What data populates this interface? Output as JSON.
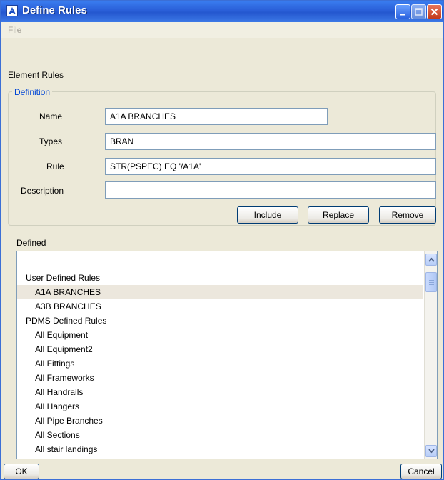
{
  "window": {
    "title": "Define Rules",
    "icon": "app-logo-icon",
    "controls": [
      "minimize-icon",
      "maximize-icon",
      "close-icon"
    ]
  },
  "menu": {
    "file": "File"
  },
  "section_title": "Element Rules",
  "definition": {
    "group_title": "Definition",
    "name_label": "Name",
    "name_value": "A1A BRANCHES",
    "types_label": "Types",
    "types_value": "BRAN",
    "rule_label": "Rule",
    "rule_value": "STR(PSPEC) EQ '/A1A'",
    "description_label": "Description",
    "description_value": "",
    "include_button": "Include",
    "replace_button": "Replace",
    "remove_button": "Remove"
  },
  "defined": {
    "label": "Defined",
    "items": [
      {
        "label": "User Defined Rules",
        "level": 0,
        "selected": false
      },
      {
        "label": "A1A BRANCHES",
        "level": 1,
        "selected": true
      },
      {
        "label": "A3B BRANCHES",
        "level": 1,
        "selected": false
      },
      {
        "label": "PDMS Defined Rules",
        "level": 0,
        "selected": false
      },
      {
        "label": "All Equipment",
        "level": 1,
        "selected": false
      },
      {
        "label": "All Equipment2",
        "level": 1,
        "selected": false
      },
      {
        "label": "All Fittings",
        "level": 1,
        "selected": false
      },
      {
        "label": "All Frameworks",
        "level": 1,
        "selected": false
      },
      {
        "label": "All Handrails",
        "level": 1,
        "selected": false
      },
      {
        "label": "All Hangers",
        "level": 1,
        "selected": false
      },
      {
        "label": "All Pipe Branches",
        "level": 1,
        "selected": false
      },
      {
        "label": "All Sections",
        "level": 1,
        "selected": false
      },
      {
        "label": "All stair landings",
        "level": 1,
        "selected": false
      }
    ]
  },
  "footer": {
    "ok_button": "OK",
    "cancel_button": "Cancel"
  },
  "colors": {
    "titlebar": "#2457cf",
    "window_bg": "#ece9d8",
    "group_title": "#0046d5",
    "selected_row": "#ece7dd"
  }
}
